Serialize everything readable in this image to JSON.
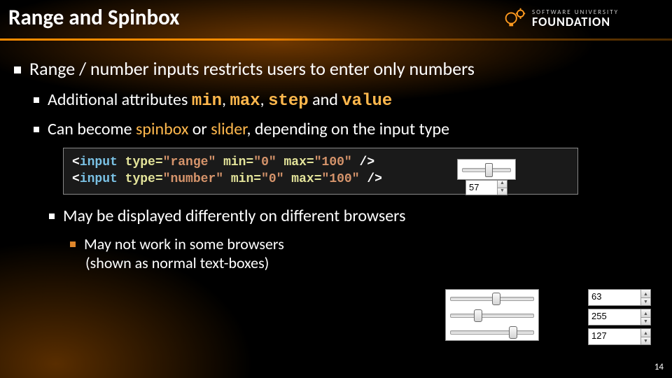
{
  "logo": {
    "upper": "SOFTWARE UNIVERSITY",
    "lower": "FOUNDATION"
  },
  "title": "Range and Spinbox",
  "bullets": {
    "l1": "Range / number inputs restricts users to enter only numbers",
    "l2a_pre": "Additional attributes ",
    "attrs": {
      "min": "min",
      "max": "max",
      "step": "step",
      "value": "value"
    },
    "and": " and ",
    "comma": ", ",
    "l2b_pre": "Can become ",
    "l2b_spin": "spinbox",
    "l2b_mid": " or ",
    "l2b_slider": "slider",
    "l2b_post": ", depending on the input type",
    "l2c": "May be displayed differently on different browsers",
    "l3a": "May not work in some browsers",
    "l3b": "(shown as normal text-boxes)"
  },
  "code": {
    "line1": {
      "tag": "input",
      "t": "type=",
      "tv": "\"range\"",
      "m": " min=",
      "mv": "\"0\"",
      "x": " max=",
      "xv": "\"100\""
    },
    "line2": {
      "tag": "input",
      "t": "type=",
      "tv": "\"number\"",
      "m": " min=",
      "mv": "\"0\"",
      "x": " max=",
      "xv": "\"100\""
    }
  },
  "widgets": {
    "num1": "57",
    "sliderPositions": [
      50,
      30,
      70
    ],
    "nums": [
      "63",
      "255",
      "127"
    ]
  },
  "page": "14"
}
